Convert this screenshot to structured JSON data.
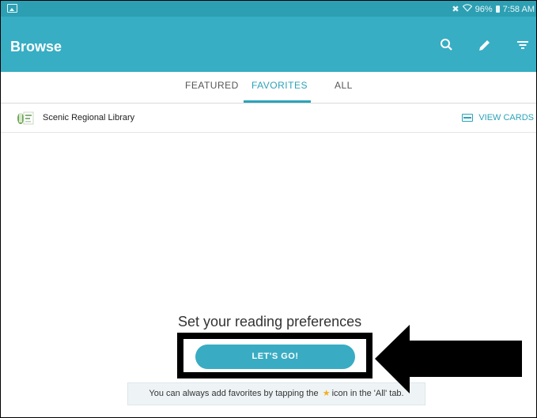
{
  "status_bar": {
    "battery": "96%",
    "time": "7:58 AM",
    "icons": [
      "gallery-icon",
      "mute-icon",
      "wifi-icon",
      "battery-icon"
    ]
  },
  "app_bar": {
    "title": "Browse",
    "actions": [
      "search-icon",
      "edit-icon",
      "filter-icon"
    ]
  },
  "tabs": {
    "items": [
      {
        "label": "FEATURED",
        "active": false
      },
      {
        "label": "FAVORITES",
        "active": true
      },
      {
        "label": "ALL",
        "active": false
      }
    ]
  },
  "library": {
    "name": "Scenic Regional Library",
    "view_cards": "VIEW CARDS"
  },
  "content": {
    "title": "Set your reading preferences",
    "button": "LET'S GO!",
    "hint_before": "You can always add favorites by tapping the",
    "hint_after": "icon in the 'All' tab."
  },
  "colors": {
    "status_bar": "#2c9fb3",
    "app_bar": "#37aec4",
    "accent": "#2ba3b9",
    "star": "#f2b01e"
  }
}
